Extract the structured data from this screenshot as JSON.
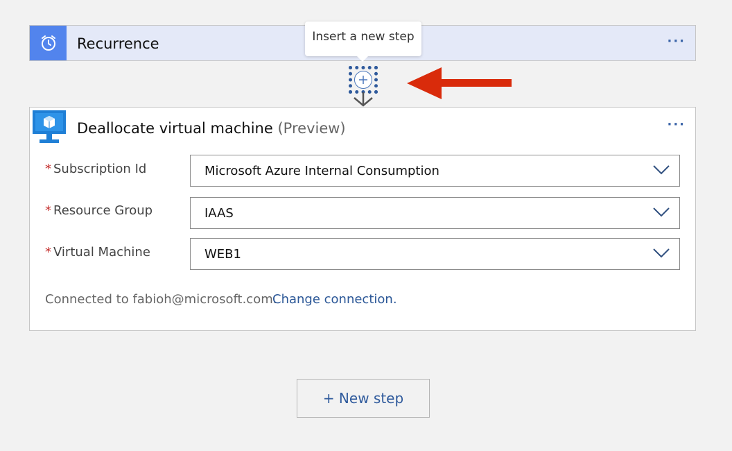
{
  "recurrence": {
    "title": "Recurrence",
    "more": "···"
  },
  "tooltip": {
    "text": "Insert a new step"
  },
  "insert_step": {
    "icon": "plus-icon"
  },
  "action_card": {
    "title": "Deallocate virtual machine",
    "title_suffix": "(Preview)",
    "more": "···",
    "fields": [
      {
        "required_mark": "*",
        "label": "Subscription Id",
        "value": "Microsoft Azure Internal Consumption"
      },
      {
        "required_mark": "*",
        "label": "Resource Group",
        "value": "IAAS"
      },
      {
        "required_mark": "*",
        "label": "Virtual Machine",
        "value": "WEB1"
      }
    ],
    "connection_text": "Connected to fabioh@microsoft.com.",
    "change_connection": "Change connection."
  },
  "new_step": {
    "label": "+ New step"
  },
  "colors": {
    "recurrence_header": "#e4e9f8",
    "recurrence_icon_bg": "#5284ed",
    "accent_link": "#2b5797",
    "required": "#c5312f",
    "red_arrow": "#d92b0b"
  }
}
